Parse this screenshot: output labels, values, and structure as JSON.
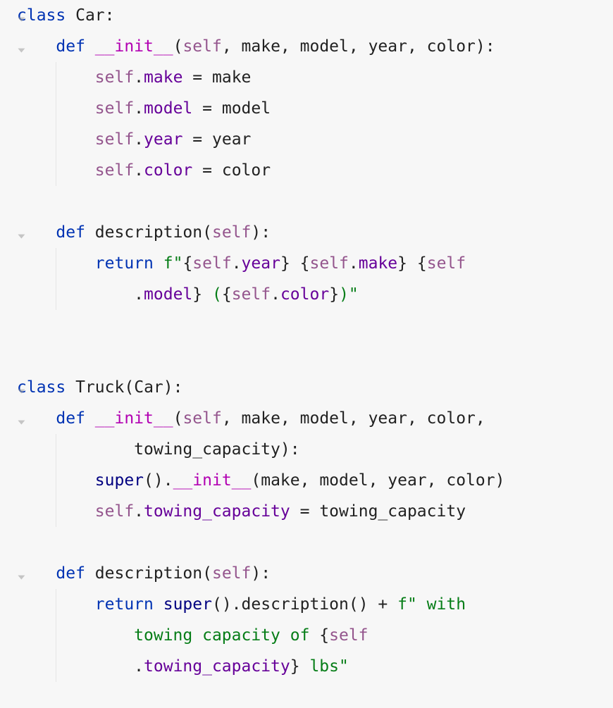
{
  "code": {
    "lines": [
      {
        "fold": true,
        "guides": [],
        "tokens": [
          [
            "kw",
            "class"
          ],
          [
            "",
            ""
          ],
          [
            "fn",
            " Car"
          ],
          [
            "punct",
            ":"
          ]
        ]
      },
      {
        "fold": true,
        "guides": [],
        "tokens": [
          [
            "",
            "    "
          ],
          [
            "kw",
            "def"
          ],
          [
            "",
            " "
          ],
          [
            "magic",
            "__init__"
          ],
          [
            "punct",
            "("
          ],
          [
            "self",
            "self"
          ],
          [
            "punct",
            ", "
          ],
          [
            "param",
            "make"
          ],
          [
            "punct",
            ", "
          ],
          [
            "param",
            "model"
          ],
          [
            "punct",
            ", "
          ],
          [
            "param",
            "year"
          ],
          [
            "punct",
            ", "
          ],
          [
            "param",
            "color"
          ],
          [
            "punct",
            "):"
          ]
        ]
      },
      {
        "fold": false,
        "guides": [
          1
        ],
        "tokens": [
          [
            "",
            "        "
          ],
          [
            "self",
            "self"
          ],
          [
            "punct",
            "."
          ],
          [
            "attr",
            "make"
          ],
          [
            "",
            " "
          ],
          [
            "op",
            "="
          ],
          [
            "",
            " "
          ],
          [
            "",
            "make"
          ]
        ]
      },
      {
        "fold": false,
        "guides": [
          1
        ],
        "tokens": [
          [
            "",
            "        "
          ],
          [
            "self",
            "self"
          ],
          [
            "punct",
            "."
          ],
          [
            "attr",
            "model"
          ],
          [
            "",
            " "
          ],
          [
            "op",
            "="
          ],
          [
            "",
            " "
          ],
          [
            "",
            "model"
          ]
        ]
      },
      {
        "fold": false,
        "guides": [
          1
        ],
        "tokens": [
          [
            "",
            "        "
          ],
          [
            "self",
            "self"
          ],
          [
            "punct",
            "."
          ],
          [
            "attr",
            "year"
          ],
          [
            "",
            " "
          ],
          [
            "op",
            "="
          ],
          [
            "",
            " "
          ],
          [
            "",
            "year"
          ]
        ]
      },
      {
        "fold": false,
        "guides": [
          1
        ],
        "tokens": [
          [
            "",
            "        "
          ],
          [
            "self",
            "self"
          ],
          [
            "punct",
            "."
          ],
          [
            "attr",
            "color"
          ],
          [
            "",
            " "
          ],
          [
            "op",
            "="
          ],
          [
            "",
            " "
          ],
          [
            "",
            "color"
          ]
        ]
      },
      {
        "fold": false,
        "guides": [],
        "tokens": [
          [
            "",
            ""
          ]
        ]
      },
      {
        "fold": true,
        "guides": [],
        "tokens": [
          [
            "",
            "    "
          ],
          [
            "kw",
            "def"
          ],
          [
            "",
            " "
          ],
          [
            "fn",
            "description"
          ],
          [
            "punct",
            "("
          ],
          [
            "self",
            "self"
          ],
          [
            "punct",
            "):"
          ]
        ]
      },
      {
        "fold": false,
        "guides": [
          1
        ],
        "tokens": [
          [
            "",
            "        "
          ],
          [
            "kw",
            "return"
          ],
          [
            "",
            " "
          ],
          [
            "str",
            "f\""
          ],
          [
            "punct",
            "{"
          ],
          [
            "self",
            "self"
          ],
          [
            "punct",
            "."
          ],
          [
            "attr",
            "year"
          ],
          [
            "punct",
            "}"
          ],
          [
            "str",
            " "
          ],
          [
            "punct",
            "{"
          ],
          [
            "self",
            "self"
          ],
          [
            "punct",
            "."
          ],
          [
            "attr",
            "make"
          ],
          [
            "punct",
            "}"
          ],
          [
            "str",
            " "
          ],
          [
            "punct",
            "{"
          ],
          [
            "self",
            "self"
          ]
        ]
      },
      {
        "fold": false,
        "guides": [
          1
        ],
        "tokens": [
          [
            "",
            "            "
          ],
          [
            "punct",
            "."
          ],
          [
            "attr",
            "model"
          ],
          [
            "punct",
            "}"
          ],
          [
            "str",
            " ("
          ],
          [
            "punct",
            "{"
          ],
          [
            "self",
            "self"
          ],
          [
            "punct",
            "."
          ],
          [
            "attr",
            "color"
          ],
          [
            "punct",
            "}"
          ],
          [
            "str",
            ")\""
          ]
        ]
      },
      {
        "fold": false,
        "guides": [],
        "tokens": [
          [
            "",
            ""
          ]
        ]
      },
      {
        "fold": false,
        "guides": [],
        "tokens": [
          [
            "",
            ""
          ]
        ]
      },
      {
        "fold": true,
        "guides": [],
        "tokens": [
          [
            "kw",
            "class"
          ],
          [
            "",
            " "
          ],
          [
            "fn",
            "Truck"
          ],
          [
            "punct",
            "("
          ],
          [
            "",
            "Car"
          ],
          [
            "punct",
            "):"
          ]
        ]
      },
      {
        "fold": true,
        "guides": [],
        "tokens": [
          [
            "",
            "    "
          ],
          [
            "kw",
            "def"
          ],
          [
            "",
            " "
          ],
          [
            "magic",
            "__init__"
          ],
          [
            "punct",
            "("
          ],
          [
            "self",
            "self"
          ],
          [
            "punct",
            ", "
          ],
          [
            "param",
            "make"
          ],
          [
            "punct",
            ", "
          ],
          [
            "param",
            "model"
          ],
          [
            "punct",
            ", "
          ],
          [
            "param",
            "year"
          ],
          [
            "punct",
            ", "
          ],
          [
            "param",
            "color"
          ],
          [
            "punct",
            ","
          ]
        ]
      },
      {
        "fold": false,
        "guides": [
          1
        ],
        "tokens": [
          [
            "",
            "            "
          ],
          [
            "param",
            "towing_capacity"
          ],
          [
            "punct",
            "):"
          ]
        ]
      },
      {
        "fold": false,
        "guides": [
          1
        ],
        "tokens": [
          [
            "",
            "        "
          ],
          [
            "builtin",
            "super"
          ],
          [
            "punct",
            "()."
          ],
          [
            "magic",
            "__init__"
          ],
          [
            "punct",
            "("
          ],
          [
            "",
            "make"
          ],
          [
            "punct",
            ", "
          ],
          [
            "",
            "model"
          ],
          [
            "punct",
            ", "
          ],
          [
            "",
            "year"
          ],
          [
            "punct",
            ", "
          ],
          [
            "",
            "color"
          ],
          [
            "punct",
            ")"
          ]
        ]
      },
      {
        "fold": false,
        "guides": [
          1
        ],
        "tokens": [
          [
            "",
            "        "
          ],
          [
            "self",
            "self"
          ],
          [
            "punct",
            "."
          ],
          [
            "attr",
            "towing_capacity"
          ],
          [
            "",
            " "
          ],
          [
            "op",
            "="
          ],
          [
            "",
            " "
          ],
          [
            "",
            "towing_capacity"
          ]
        ]
      },
      {
        "fold": false,
        "guides": [],
        "tokens": [
          [
            "",
            ""
          ]
        ]
      },
      {
        "fold": true,
        "guides": [],
        "tokens": [
          [
            "",
            "    "
          ],
          [
            "kw",
            "def"
          ],
          [
            "",
            " "
          ],
          [
            "fn",
            "description"
          ],
          [
            "punct",
            "("
          ],
          [
            "self",
            "self"
          ],
          [
            "punct",
            "):"
          ]
        ]
      },
      {
        "fold": false,
        "guides": [
          1
        ],
        "tokens": [
          [
            "",
            "        "
          ],
          [
            "kw",
            "return"
          ],
          [
            "",
            " "
          ],
          [
            "builtin",
            "super"
          ],
          [
            "punct",
            "()."
          ],
          [
            "fn",
            "description"
          ],
          [
            "punct",
            "()"
          ],
          [
            "",
            " "
          ],
          [
            "op",
            "+"
          ],
          [
            "",
            " "
          ],
          [
            "str",
            "f\" with"
          ]
        ]
      },
      {
        "fold": false,
        "guides": [
          1
        ],
        "tokens": [
          [
            "",
            "            "
          ],
          [
            "str",
            "towing capacity of "
          ],
          [
            "punct",
            "{"
          ],
          [
            "self",
            "self"
          ]
        ]
      },
      {
        "fold": false,
        "guides": [
          1
        ],
        "tokens": [
          [
            "",
            "            "
          ],
          [
            "punct",
            "."
          ],
          [
            "attr",
            "towing_capacity"
          ],
          [
            "punct",
            "}"
          ],
          [
            "str",
            " lbs\""
          ]
        ]
      }
    ]
  },
  "colors": {
    "keyword": "#0033b3",
    "magic": "#b200b2",
    "self": "#94558d",
    "attr": "#660099",
    "string": "#067d17",
    "builtin": "#000080",
    "background": "#f7f7f7"
  }
}
